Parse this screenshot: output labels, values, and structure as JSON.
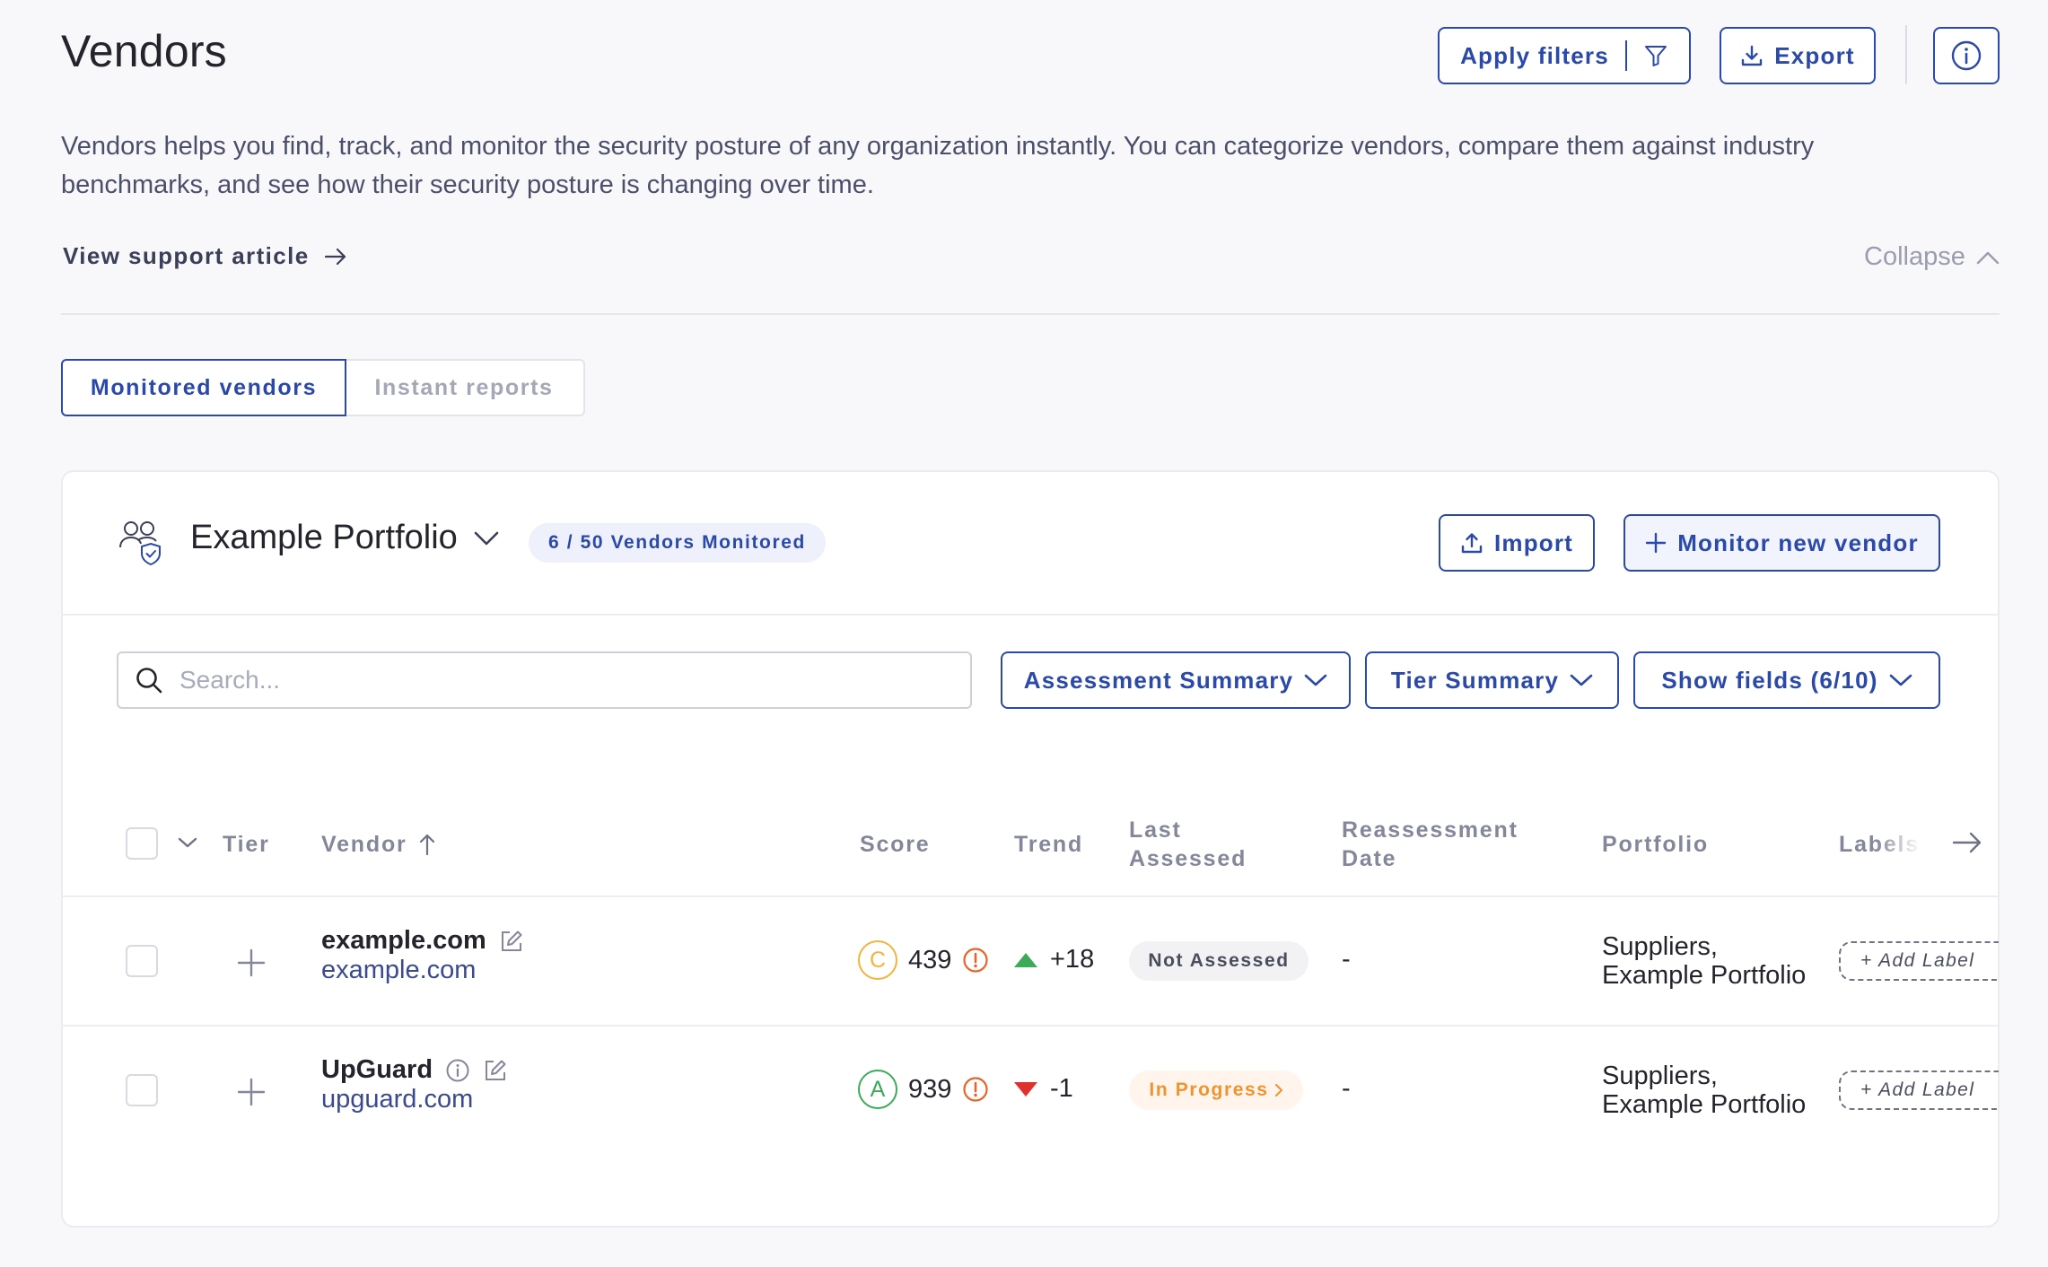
{
  "header": {
    "title": "Vendors",
    "apply_filters_label": "Apply filters",
    "export_label": "Export",
    "description": "Vendors helps you find, track, and monitor the security posture of any organization instantly. You can categorize vendors, compare them against industry benchmarks, and see how their security posture is changing over time.",
    "support_link_label": "View support article",
    "collapse_label": "Collapse"
  },
  "tabs": [
    {
      "label": "Monitored vendors",
      "active": true
    },
    {
      "label": "Instant reports",
      "active": false
    }
  ],
  "portfolio": {
    "name": "Example Portfolio",
    "vendor_count": "6 / 50 Vendors Monitored",
    "import_label": "Import",
    "monitor_label": "Monitor new vendor"
  },
  "toolbar": {
    "search_placeholder": "Search...",
    "assessment_summary_label": "Assessment Summary",
    "tier_summary_label": "Tier Summary",
    "show_fields_label": "Show fields (6/10)"
  },
  "table": {
    "columns": {
      "tier": "Tier",
      "vendor": "Vendor",
      "score": "Score",
      "trend": "Trend",
      "last_assessed_1": "Last",
      "last_assessed_2": "Assessed",
      "reassessment_1": "Reassessment",
      "reassessment_2": "Date",
      "portfolio": "Portfolio",
      "labels": "Labels"
    },
    "rows": [
      {
        "vendor_name": "example.com",
        "domain": "example.com",
        "grade": "C",
        "score": "439",
        "trend_direction": "up",
        "trend": "+18",
        "last_assessed": "Not Assessed",
        "reassessment_date": "-",
        "portfolio_line1": "Suppliers,",
        "portfolio_line2": "Example Portfolio",
        "add_label": "+ Add Label"
      },
      {
        "vendor_name": "UpGuard",
        "domain": "upguard.com",
        "grade": "A",
        "score": "939",
        "trend_direction": "down",
        "trend": "-1",
        "last_assessed": "In Progress",
        "reassessment_date": "-",
        "portfolio_line1": "Suppliers,",
        "portfolio_line2": "Example Portfolio",
        "add_label": "+ Add Label"
      }
    ]
  },
  "colors": {
    "primary": "#2b49a8",
    "grade_c": "#f2b43c",
    "grade_a": "#3daa5a",
    "trend_up": "#3daa5a",
    "trend_down": "#e0312f",
    "warning": "#e8632a",
    "in_progress": "#f0932e"
  }
}
